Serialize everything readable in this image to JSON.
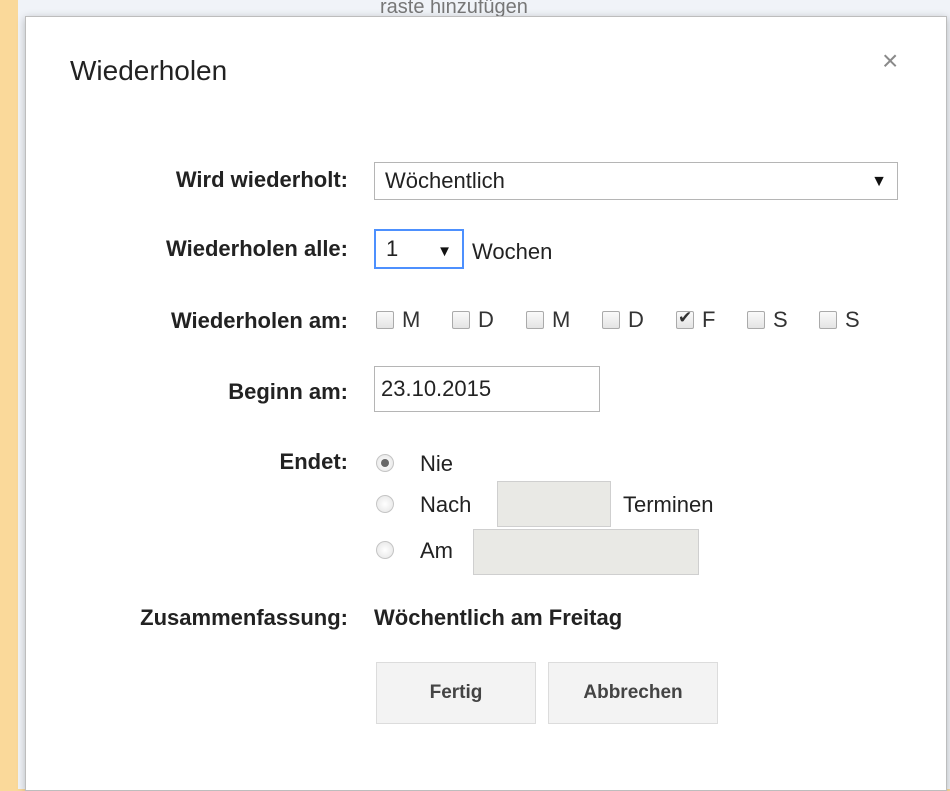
{
  "background": {
    "partial_text": "raste hinzufügen"
  },
  "dialog": {
    "title": "Wiederholen",
    "close_symbol": "×",
    "repeat": {
      "label": "Wird wiederholt:",
      "value": "Wöchentlich"
    },
    "every": {
      "label": "Wiederholen alle:",
      "value": "1",
      "unit": "Wochen"
    },
    "on": {
      "label": "Wiederholen am:",
      "days": [
        {
          "letter": "M",
          "checked": false
        },
        {
          "letter": "D",
          "checked": false
        },
        {
          "letter": "M",
          "checked": false
        },
        {
          "letter": "D",
          "checked": false
        },
        {
          "letter": "F",
          "checked": true
        },
        {
          "letter": "S",
          "checked": false
        },
        {
          "letter": "S",
          "checked": false
        }
      ]
    },
    "start": {
      "label": "Beginn am:",
      "value": "23.10.2015"
    },
    "ends": {
      "label": "Endet:",
      "never": "Nie",
      "after": "Nach",
      "after_unit": "Terminen",
      "on": "Am"
    },
    "summary": {
      "label": "Zusammenfassung:",
      "value": "Wöchentlich am Freitag"
    },
    "buttons": {
      "done": "Fertig",
      "cancel": "Abbrechen"
    }
  }
}
